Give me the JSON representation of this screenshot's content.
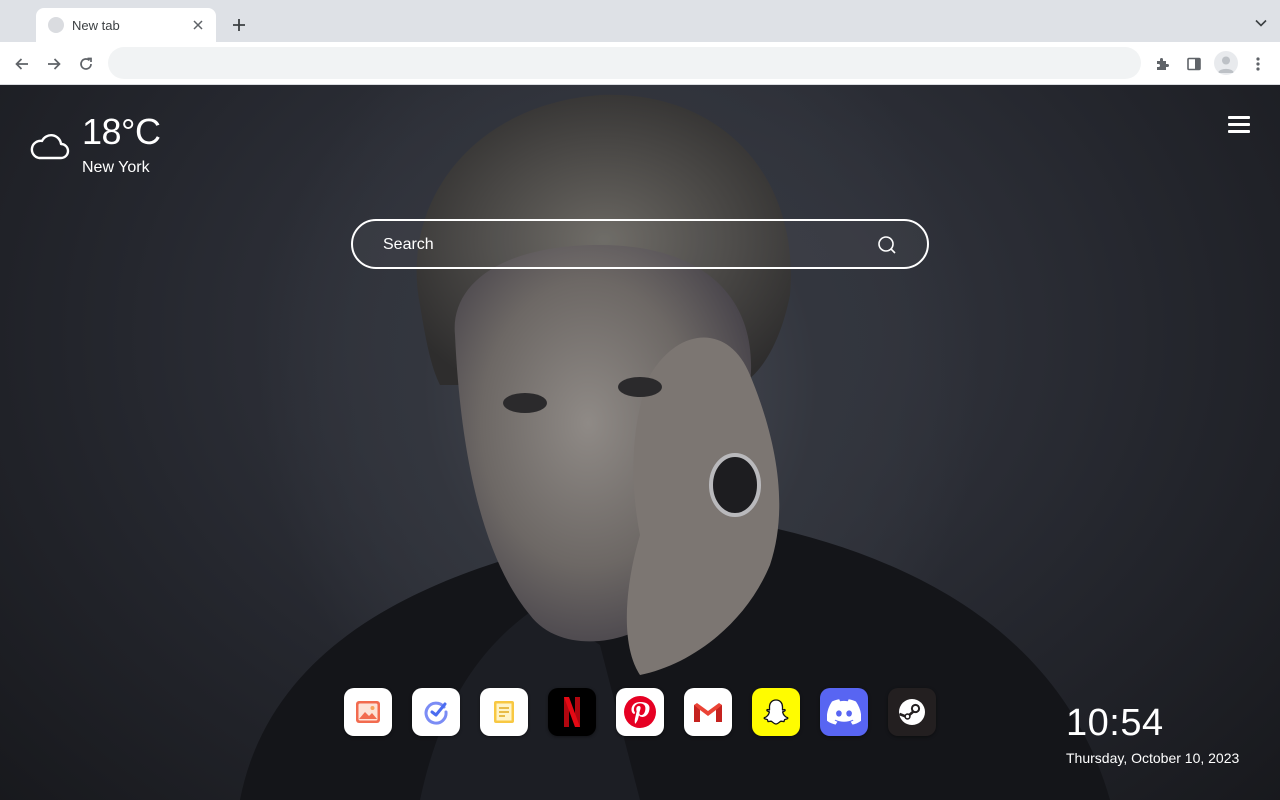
{
  "browser": {
    "tab_title": "New tab",
    "omnibox_value": ""
  },
  "weather": {
    "icon": "cloud-icon",
    "temperature": "18°C",
    "city": "New York"
  },
  "search": {
    "placeholder": "Search"
  },
  "apps": [
    {
      "name": "photos",
      "icon": "image-icon",
      "bg": "#ffffff"
    },
    {
      "name": "tasks",
      "icon": "check-circle-icon",
      "bg": "#ffffff"
    },
    {
      "name": "notes",
      "icon": "note-icon",
      "bg": "#ffffff"
    },
    {
      "name": "netflix",
      "icon": "netflix-icon",
      "bg": "#000000"
    },
    {
      "name": "pinterest",
      "icon": "pinterest-icon",
      "bg": "#ffffff"
    },
    {
      "name": "gmail",
      "icon": "gmail-icon",
      "bg": "#ffffff"
    },
    {
      "name": "snapchat",
      "icon": "snapchat-icon",
      "bg": "#fffc00"
    },
    {
      "name": "discord",
      "icon": "discord-icon",
      "bg": "#5865f2"
    },
    {
      "name": "steam",
      "icon": "steam-icon",
      "bg": "#231f20"
    }
  ],
  "clock": {
    "time": "10:54",
    "date": "Thursday, October 10, 2023"
  }
}
